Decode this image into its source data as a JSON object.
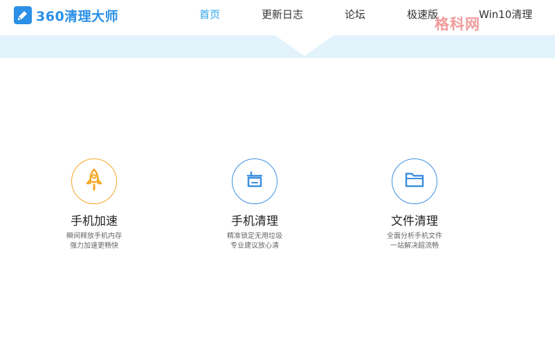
{
  "header": {
    "logo_text": "360清理大师",
    "nav": [
      {
        "label": "首页",
        "active": true
      },
      {
        "label": "更新日志",
        "active": false
      },
      {
        "label": "论坛",
        "active": false
      },
      {
        "label": "极速版",
        "active": false
      },
      {
        "label": "Win10清理",
        "active": false
      }
    ],
    "watermark": "格科网"
  },
  "features": [
    {
      "title": "手机加速",
      "desc_line1": "瞬间释放手机内存",
      "desc_line2": "强力加速更畅快",
      "icon": "rocket-icon",
      "color": "#f5a623"
    },
    {
      "title": "手机清理",
      "desc_line1": "精准锁定无用垃圾",
      "desc_line2": "专业建议放心清",
      "icon": "broom-icon",
      "color": "#3b8fe0"
    },
    {
      "title": "文件清理",
      "desc_line1": "全面分析手机文件",
      "desc_line2": "一站解决超流畅",
      "icon": "folder-icon",
      "color": "#3b8fe0"
    }
  ],
  "colors": {
    "accent": "#29a3e8",
    "brand": "#2a8fe6",
    "band": "#e3f3fb",
    "orange": "#f5a623"
  }
}
